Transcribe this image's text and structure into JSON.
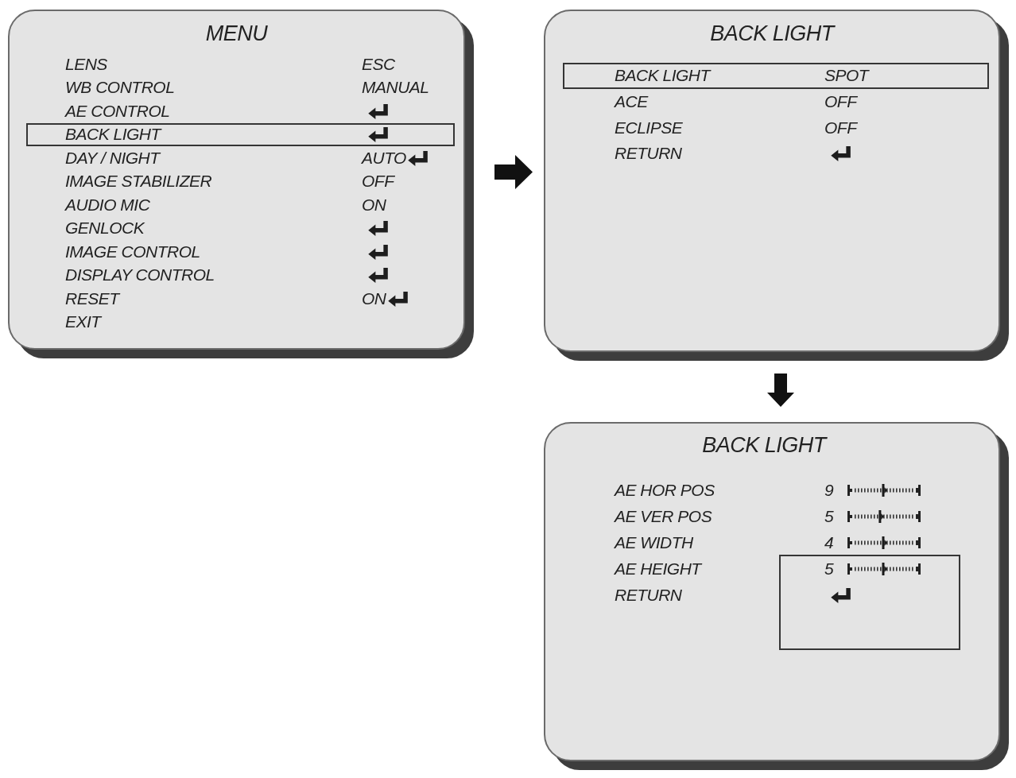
{
  "menu": {
    "title": "MENU",
    "items": [
      {
        "kind": "option",
        "label": "LENS",
        "value": "ESC",
        "enter": false,
        "selected": false
      },
      {
        "kind": "option",
        "label": "WB CONTROL",
        "value": "MANUAL",
        "enter": false,
        "selected": false
      },
      {
        "kind": "option",
        "label": "AE CONTROL",
        "enter": true,
        "selected": false
      },
      {
        "kind": "option",
        "label": "BACK LIGHT",
        "enter": true,
        "selected": true
      },
      {
        "kind": "option",
        "label": "DAY / NIGHT",
        "value": "AUTO",
        "enter": true,
        "selected": false
      },
      {
        "kind": "option",
        "label": "IMAGE STABILIZER",
        "value": "OFF",
        "enter": false,
        "selected": false
      },
      {
        "kind": "option",
        "label": "AUDIO MIC",
        "value": "ON",
        "enter": false,
        "selected": false
      },
      {
        "kind": "option",
        "label": "GENLOCK",
        "enter": true,
        "selected": false
      },
      {
        "kind": "option",
        "label": "IMAGE CONTROL",
        "enter": true,
        "selected": false
      },
      {
        "kind": "option",
        "label": "DISPLAY CONTROL",
        "enter": true,
        "selected": false
      },
      {
        "kind": "option",
        "label": "RESET",
        "value": "ON",
        "enter": true,
        "selected": false
      },
      {
        "kind": "option",
        "label": "EXIT",
        "enter": false,
        "selected": false
      }
    ]
  },
  "back_light_menu": {
    "title": "BACK LIGHT",
    "items": [
      {
        "kind": "option",
        "label": "BACK LIGHT",
        "value": "SPOT",
        "enter": false,
        "selected": true
      },
      {
        "kind": "option",
        "label": "ACE",
        "value": "OFF",
        "enter": false,
        "selected": false
      },
      {
        "kind": "option",
        "label": "ECLIPSE",
        "value": "OFF",
        "enter": false,
        "selected": false
      },
      {
        "kind": "option",
        "label": "RETURN",
        "enter": true,
        "selected": false
      }
    ]
  },
  "spot_menu": {
    "title": "BACK LIGHT",
    "items": [
      {
        "kind": "slider",
        "label": "AE HOR POS",
        "value": "9",
        "level": 0.5
      },
      {
        "kind": "slider",
        "label": "AE VER POS",
        "value": "5",
        "level": 0.45
      },
      {
        "kind": "slider",
        "label": "AE WIDTH",
        "value": "4",
        "level": 0.5
      },
      {
        "kind": "slider",
        "label": "AE HEIGHT",
        "value": "5",
        "level": 0.5
      },
      {
        "kind": "option",
        "label": "RETURN",
        "enter": true
      }
    ]
  }
}
